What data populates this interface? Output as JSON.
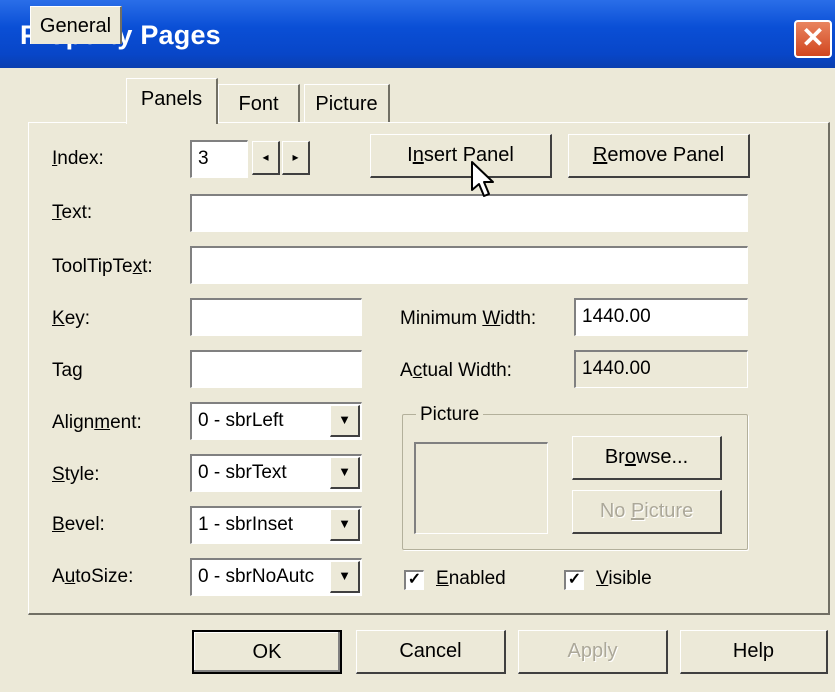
{
  "window": {
    "title": "Property Pages",
    "close_icon": "close-icon"
  },
  "tabs": [
    "General",
    "Panels",
    "Font",
    "Picture"
  ],
  "panel": {
    "index": {
      "label_u": "I",
      "label_rest": "ndex:",
      "value": "3",
      "spin_left": "◂",
      "spin_right": "▸"
    },
    "insert_panel": {
      "pre": "I",
      "u": "n",
      "post": "sert Panel"
    },
    "remove_panel": {
      "u": "R",
      "post": "emove Panel"
    },
    "text": {
      "u": "T",
      "post": "ext:",
      "value": ""
    },
    "tooltip": {
      "pre": "ToolTipTe",
      "u": "x",
      "post": "t:",
      "value": ""
    },
    "key": {
      "u": "K",
      "post": "ey:",
      "value": ""
    },
    "tag": {
      "pre": "Ta",
      "u": "g",
      "post": "",
      "value": ""
    },
    "minimum_width": {
      "pre": "Minimum ",
      "u": "W",
      "post": "idth:",
      "value": "1440.00"
    },
    "actual_width": {
      "pre": "A",
      "u": "c",
      "post": "tual Width:",
      "value": "1440.00"
    },
    "alignment": {
      "pre": "Align",
      "u": "m",
      "post": "ent:",
      "value": "0 - sbrLeft"
    },
    "style": {
      "u": "S",
      "post": "tyle:",
      "value": "0 - sbrText"
    },
    "bevel": {
      "u": "B",
      "post": "evel:",
      "value": "1 - sbrInset"
    },
    "autosize": {
      "pre": "A",
      "u": "u",
      "post": "toSize:",
      "value": "0 - sbrNoAutc"
    },
    "picture_group": "Picture",
    "browse": {
      "pre": "Br",
      "u": "o",
      "post": "wse..."
    },
    "no_picture": {
      "pre": "No ",
      "u": "P",
      "post": "icture"
    },
    "enabled": {
      "u": "E",
      "post": "nabled",
      "checked": true
    },
    "visible": {
      "u": "V",
      "post": "isible",
      "checked": true
    },
    "check_glyph": "✓",
    "dropdown_glyph": "▼"
  },
  "footer": {
    "ok": "OK",
    "cancel": "Cancel",
    "apply": "Apply",
    "help": "Help"
  }
}
